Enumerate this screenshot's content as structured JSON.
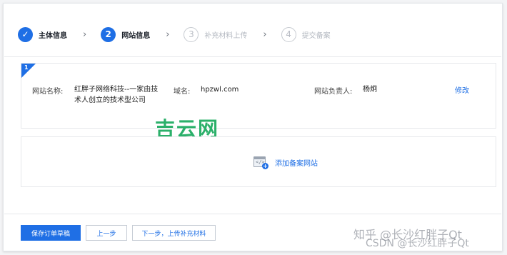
{
  "steps": [
    {
      "number": "✓",
      "label": "主体信息",
      "state": "done"
    },
    {
      "number": "2",
      "label": "网站信息",
      "state": "active"
    },
    {
      "number": "3",
      "label": "补充材料上传",
      "state": "pending"
    },
    {
      "number": "4",
      "label": "提交备案",
      "state": "pending"
    }
  ],
  "separator": "›",
  "site_card": {
    "index": "1",
    "name_label": "网站名称:",
    "name_value_line1": "红胖子网络科技--一家由技",
    "name_value_line2": "术人创立的技术型公司",
    "domain_label": "域名:",
    "domain_value": "hpzwl.com",
    "owner_label": "网站负责人:",
    "owner_value": "杨炯",
    "edit_label": "修改"
  },
  "watermark_jiyun": "吉云网",
  "add_site": {
    "code_glyph": "</>",
    "plus": "+",
    "label": "添加备案网站"
  },
  "footer": {
    "save_label": "保存订单草稿",
    "prev_label": "上一步",
    "next_label": "下一步，上传补充材料"
  },
  "watermark_zhihu": "知乎 @长沙红胖子Qt",
  "watermark_csdn": "CSDN @长沙红胖子Qt",
  "colors": {
    "accent": "#1f6fe5",
    "watermark_green": "#2bb06a"
  }
}
